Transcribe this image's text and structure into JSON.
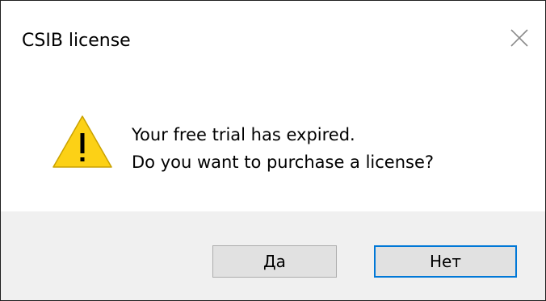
{
  "dialog": {
    "title": "CSIB license",
    "close_icon": "close-icon",
    "icon": "warning-icon",
    "message_lines": [
      "Your free trial has expired.",
      "Do you want to purchase a license?"
    ],
    "buttons": {
      "yes_label": "Да",
      "no_label": "Нет"
    },
    "colors": {
      "warning_fill": "#fcd116",
      "default_button_border": "#0078d7",
      "footer_background": "#f0f0f0"
    }
  }
}
